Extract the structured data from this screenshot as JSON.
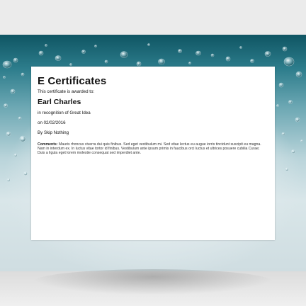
{
  "certificate": {
    "title": "E Certificates",
    "awarded_to_label": "This certificate is awarded to:",
    "recipient_name": "Earl Charles",
    "recognition": "in recognition of Great Idea",
    "date": "on 02/02/2016",
    "issuer": "By Skip Nothing",
    "comments_label": "Comments:",
    "comments_text": "Mauris rhoncus viverra dui quis finibus. Sed eget vestibulum mi. Sed vitae lectus eu augue iorris tincidunt suscipit eu magna. Nam in interdum ex. In luctus vitae tortor id finibus. Vestibulum ante ipsum primis in faucibus orci luctus et ultrices posuere cubilia Curae; Duis a ligula eget lorem molestie consequat sed imperdiet ante."
  },
  "colors": {
    "background_top": "#0f5563",
    "background_light": "#dfe9ec",
    "card": "#ffffff",
    "frame": "#ebebeb"
  }
}
